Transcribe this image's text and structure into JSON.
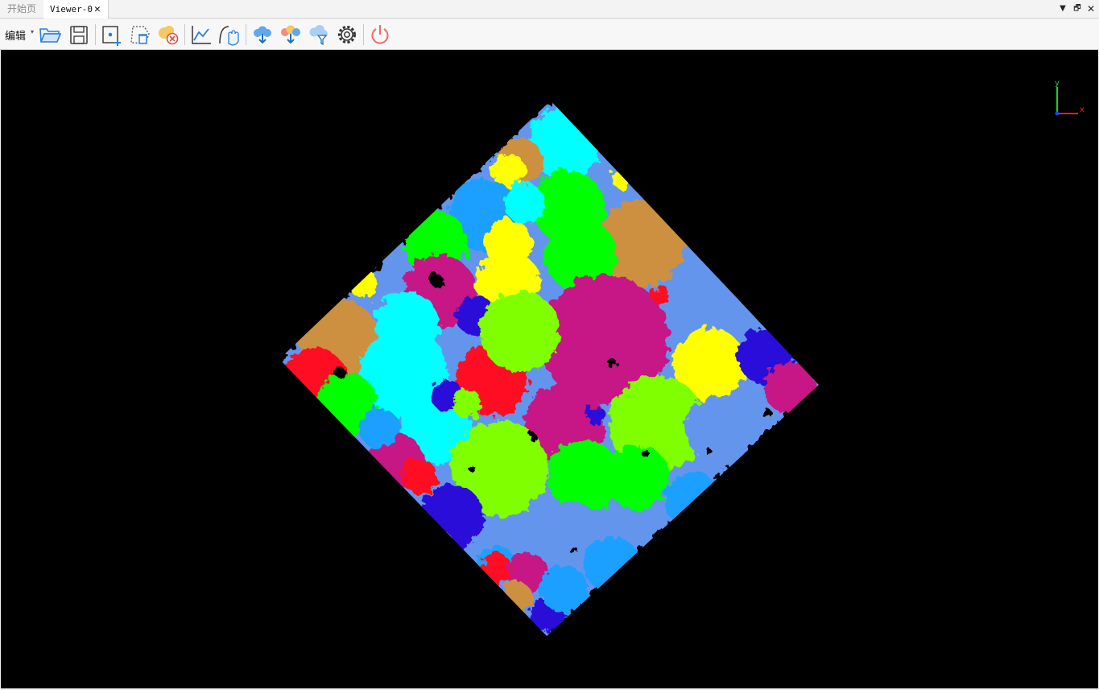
{
  "tabs": {
    "start_label": "开始页",
    "viewer_label": "Viewer-0",
    "close_glyph": "✕"
  },
  "window_controls": {
    "dropdown_glyph": "▼",
    "restore_glyph": "🗗",
    "close_glyph": "✕"
  },
  "toolbar": {
    "edit_label": "编辑",
    "edit_arrow": "▾",
    "icons": [
      "folder-open-icon",
      "save-icon",
      "add-point-icon",
      "delete-region-icon",
      "cloud-remove-icon",
      "line-chart-icon",
      "hand-curve-icon",
      "cloud-down-icon",
      "cloud-multi-icon",
      "cloud-filter-icon",
      "gear-icon",
      "power-icon"
    ]
  },
  "viewport": {
    "background": "#000000",
    "axis_labels": {
      "x": "x",
      "y": "y"
    },
    "axis_colors": {
      "x": "#ff2020",
      "y": "#20d020",
      "z": "#2040ff"
    },
    "segment_palette": [
      "#c71585",
      "#00ffff",
      "#00ff00",
      "#7fff00",
      "#ffff00",
      "#ff1020",
      "#2a0fd8",
      "#6495ed",
      "#1ea0ff",
      "#cd9040"
    ]
  }
}
